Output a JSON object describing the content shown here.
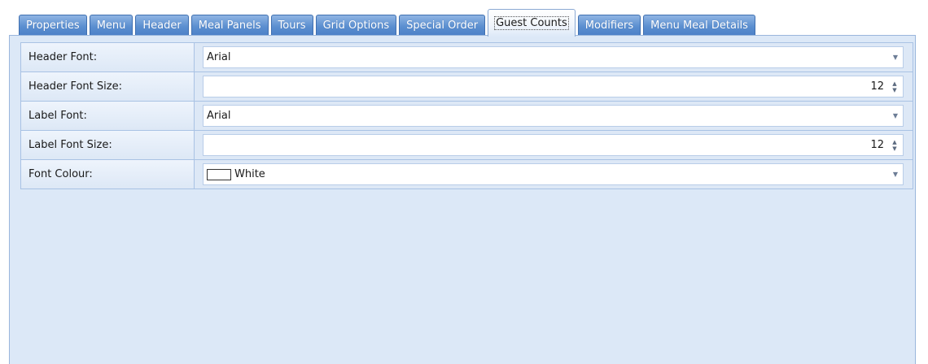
{
  "tabs": [
    {
      "label": "Properties",
      "active": false
    },
    {
      "label": "Menu",
      "active": false
    },
    {
      "label": "Header",
      "active": false
    },
    {
      "label": "Meal Panels",
      "active": false
    },
    {
      "label": "Tours",
      "active": false
    },
    {
      "label": "Grid Options",
      "active": false
    },
    {
      "label": "Special Order",
      "active": false
    },
    {
      "label": "Guest Counts",
      "active": true
    },
    {
      "label": "Modifiers",
      "active": false
    },
    {
      "label": "Menu Meal Details",
      "active": false
    }
  ],
  "properties": {
    "header_font": {
      "label": "Header Font:",
      "value": "Arial"
    },
    "header_font_size": {
      "label": "Header Font Size:",
      "value": "12"
    },
    "label_font": {
      "label": "Label Font:",
      "value": "Arial"
    },
    "label_font_size": {
      "label": "Label Font Size:",
      "value": "12"
    },
    "font_colour": {
      "label": "Font Colour:",
      "value": "White",
      "swatch_color": "#ffffff"
    }
  },
  "colors": {
    "tab_inactive": "#5b8fd0",
    "panel_background": "#dce8f7",
    "border": "#a9c2e4"
  },
  "icons": {
    "dropdown": "chevron-down-icon",
    "spinner": "spin-updown-icon"
  }
}
